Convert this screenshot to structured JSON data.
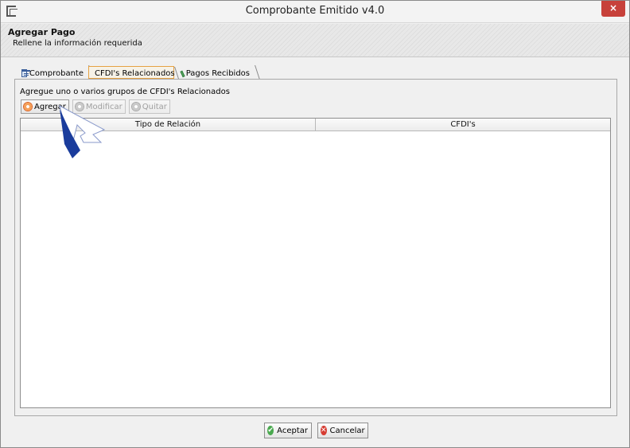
{
  "window": {
    "title": "Comprobante Emitido v4.0",
    "close_symbol": "×",
    "close_color": "#c7413a"
  },
  "header": {
    "title": "Agregar Pago",
    "subtitle": "Rellene la información requerida"
  },
  "tabs": [
    {
      "label": "Comprobante",
      "icon": "window-icon",
      "active": false
    },
    {
      "label": "CFDI's Relacionados",
      "icon": "related-icon",
      "active": true
    },
    {
      "label": "Pagos Recibidos",
      "icon": "money-icon",
      "active": false
    }
  ],
  "panel": {
    "instructions": "Agregue uno o varios grupos de CFDI's Relacionados",
    "toolbar": {
      "add_label": "Agregar",
      "edit_label": "Modificar",
      "remove_label": "Quitar"
    },
    "table": {
      "columns": [
        "Tipo de Relación",
        "CFDI's"
      ],
      "rows": []
    }
  },
  "footer": {
    "accept_label": "Aceptar",
    "cancel_label": "Cancelar"
  },
  "colors": {
    "active_tab_border": "#e6a243",
    "accept_icon": "#4aa94f",
    "cancel_icon": "#d63c32",
    "cursor_fill": "#1a3c9c"
  }
}
